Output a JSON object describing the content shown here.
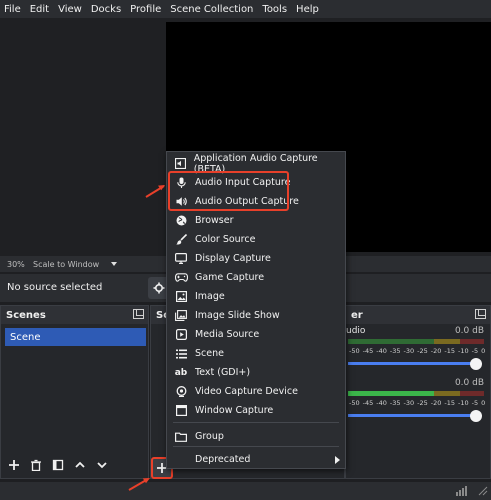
{
  "menubar": {
    "items": [
      {
        "label": "File"
      },
      {
        "label": "Edit"
      },
      {
        "label": "View"
      },
      {
        "label": "Docks"
      },
      {
        "label": "Profile"
      },
      {
        "label": "Scene Collection"
      },
      {
        "label": "Tools"
      },
      {
        "label": "Help"
      }
    ]
  },
  "zoom": {
    "percent": "30%",
    "mode": "Scale to Window"
  },
  "sourcebar": {
    "status": "No source selected"
  },
  "scenes": {
    "title": "Scenes",
    "items": [
      {
        "label": "Scene"
      }
    ]
  },
  "sources": {
    "title_partial": "Sou"
  },
  "mixer": {
    "title_partial": "er",
    "channels": [
      {
        "label_partial": "udio",
        "db": "0.0 dB"
      },
      {
        "db": "0.0 dB"
      }
    ],
    "scale": [
      "-50",
      "-45",
      "-40",
      "-35",
      "-30",
      "-25",
      "-20",
      "-15",
      "-10",
      "-5",
      "0"
    ]
  },
  "context_menu": {
    "items": [
      {
        "label": "Application Audio Capture (BETA)",
        "icon": "app-audio-icon"
      },
      {
        "label": "Audio Input Capture",
        "icon": "microphone-icon"
      },
      {
        "label": "Audio Output Capture",
        "icon": "speaker-icon"
      },
      {
        "label": "Browser",
        "icon": "globe-icon"
      },
      {
        "label": "Color Source",
        "icon": "paint-brush-icon"
      },
      {
        "label": "Display Capture",
        "icon": "monitor-icon"
      },
      {
        "label": "Game Capture",
        "icon": "gamepad-icon"
      },
      {
        "label": "Image",
        "icon": "image-icon"
      },
      {
        "label": "Image Slide Show",
        "icon": "slideshow-icon"
      },
      {
        "label": "Media Source",
        "icon": "media-icon"
      },
      {
        "label": "Scene",
        "icon": "list-icon"
      },
      {
        "label": "Text (GDI+)",
        "icon": "text-icon"
      },
      {
        "label": "Video Capture Device",
        "icon": "camera-icon"
      },
      {
        "label": "Window Capture",
        "icon": "window-icon"
      },
      {
        "label": "Group",
        "icon": "folder-icon"
      },
      {
        "label": "Deprecated",
        "icon": ""
      }
    ]
  },
  "colors": {
    "accent": "#2e5bb5",
    "highlight": "#e8402a",
    "meter_green": "#3bb54a",
    "meter_yellow": "#c9a227",
    "meter_red": "#b53b3b"
  }
}
